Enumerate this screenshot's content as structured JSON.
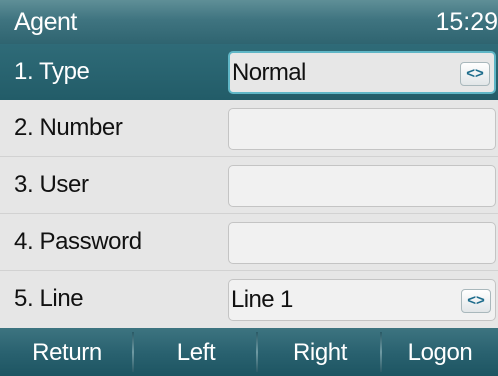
{
  "header": {
    "title": "Agent",
    "clock": "15:29"
  },
  "rows": [
    {
      "label": "1. Type",
      "value": "Normal",
      "arrows": "<>"
    },
    {
      "label": "2. Number",
      "value": ""
    },
    {
      "label": "3. User",
      "value": ""
    },
    {
      "label": "4. Password",
      "value": ""
    },
    {
      "label": "5. Line",
      "value": "Line 1",
      "arrows": "<>"
    }
  ],
  "softkeys": [
    "Return",
    "Left",
    "Right",
    "Logon"
  ]
}
